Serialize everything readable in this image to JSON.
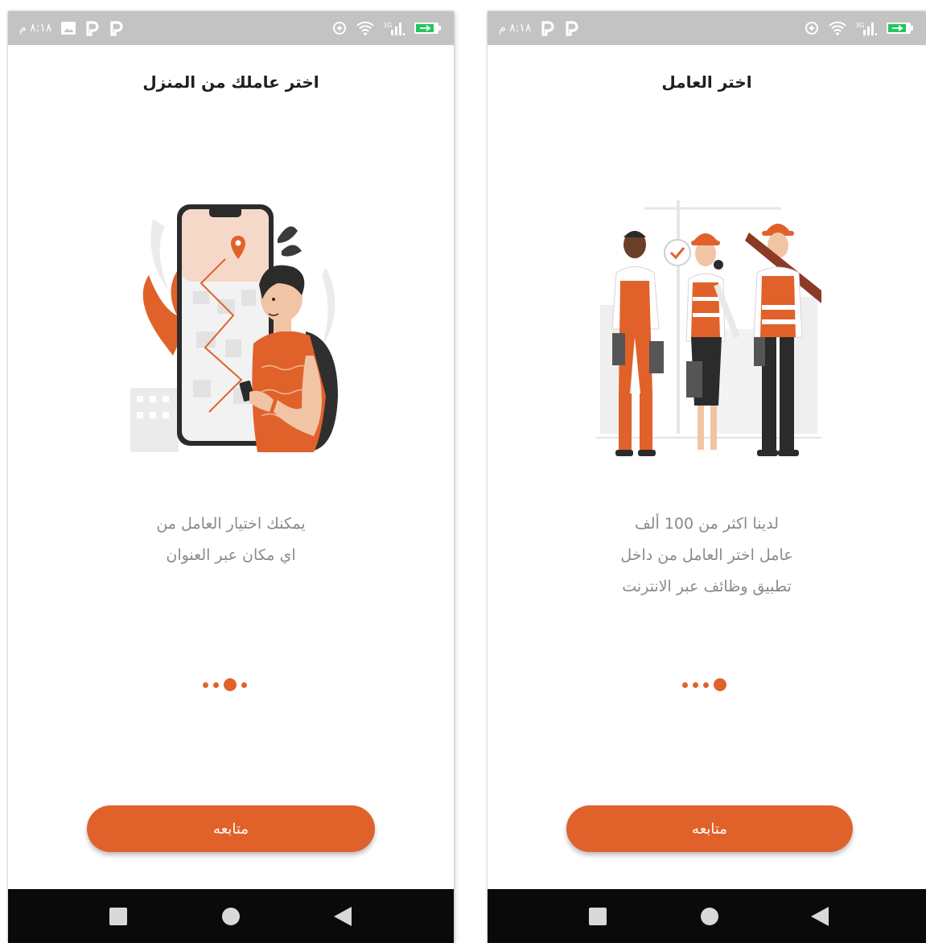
{
  "screens": [
    {
      "status_time": "٨:١٨ م",
      "title": "اختر عاملك من المنزل",
      "description_lines": [
        "يمكنك اختيار العامل من",
        "اي مكان عبر العنوان"
      ],
      "page_indicator": {
        "count": 4,
        "active_index": 2
      },
      "continue_label": "متابعه"
    },
    {
      "status_time": "٨:١٨ م",
      "title": "اختر العامل",
      "description_lines": [
        "لدينا اكثر من 100 ألف",
        "عامل اختر العامل من داخل",
        "تطبيق وظائف عبر الانترنت"
      ],
      "page_indicator": {
        "count": 4,
        "active_index": 3
      },
      "continue_label": "متابعه"
    }
  ],
  "colors": {
    "accent": "#e0622a",
    "status_bar": "#c3c3c3",
    "nav_bar": "#0a0a0a",
    "battery": "#22c55e"
  },
  "icons": {
    "status": [
      "image-icon",
      "p-icon",
      "sync-icon",
      "wifi-icon",
      "signal-icon",
      "battery-icon"
    ],
    "nav": [
      "recents-icon",
      "home-icon",
      "back-icon"
    ]
  }
}
